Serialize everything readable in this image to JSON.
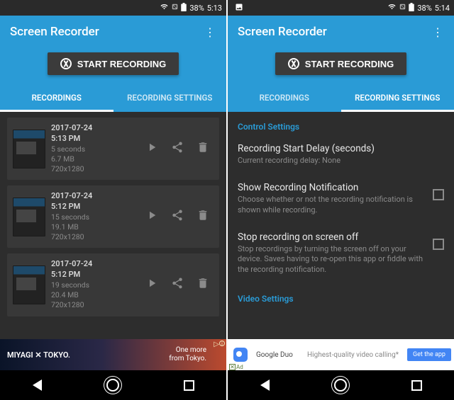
{
  "left": {
    "status": {
      "battery": "38%",
      "time": "5:13"
    },
    "app_title": "Screen Recorder",
    "start_button": "START RECORDING",
    "tabs": {
      "recordings": "RECORDINGS",
      "settings": "RECORDING SETTINGS",
      "active": 0
    },
    "recordings": [
      {
        "date": "2017-07-24",
        "time": "5:13 PM",
        "duration": "5 seconds",
        "size": "6.7 MB",
        "resolution": "720x1280"
      },
      {
        "date": "2017-07-24",
        "time": "5:12 PM",
        "duration": "15 seconds",
        "size": "19.1 MB",
        "resolution": "720x1280"
      },
      {
        "date": "2017-07-24",
        "time": "5:12 PM",
        "duration": "19 seconds",
        "size": "20.4 MB",
        "resolution": "720x1280"
      }
    ],
    "ad": {
      "brand": "MIYAGI ✕ TOKYO.",
      "tagline1": "One more",
      "tagline2": "from Tokyo."
    }
  },
  "right": {
    "status": {
      "battery": "38%",
      "time": "5:14"
    },
    "app_title": "Screen Recorder",
    "start_button": "START RECORDING",
    "tabs": {
      "recordings": "RECORDINGS",
      "settings": "RECORDING SETTINGS",
      "active": 1
    },
    "section1": "Control Settings",
    "settings": [
      {
        "title": "Recording Start Delay (seconds)",
        "desc": "Current recording delay: None",
        "checkbox": false
      },
      {
        "title": "Show Recording Notification",
        "desc": "Choose whether or not the recording notification is shown while recording.",
        "checkbox": true
      },
      {
        "title": "Stop recording on screen off",
        "desc": "Stop recordings by turning the screen off on your device. Saves having to re-open this app or fiddle with the recording notification.",
        "checkbox": true
      }
    ],
    "section2": "Video Settings",
    "ad": {
      "app_name": "Google Duo",
      "text": "Highest-quality video calling*",
      "cta": "Get the app",
      "badge": "Ad"
    }
  }
}
